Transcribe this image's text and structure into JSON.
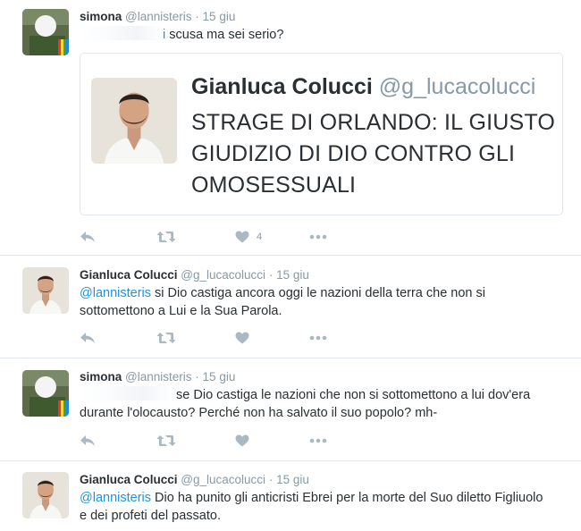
{
  "tweets": [
    {
      "name": "simona",
      "handle": "@lannisteris",
      "date": "15 giu",
      "redacted": "@g_lucacolucci",
      "redacted_tail": "i",
      "text": " scusa ma sei serio?",
      "likes": "4",
      "quote": {
        "name": "Gianluca Colucci",
        "handle": "@g_lucacolucci",
        "text": "STRAGE DI ORLANDO: IL GIUSTO GIUDIZIO DI DIO CONTRO GLI OMOSESSUALI"
      }
    },
    {
      "name": "Gianluca Colucci",
      "handle": "@g_lucacolucci",
      "date": "15 giu",
      "mention": "@lannisteris",
      "text_line1": " si Dio castiga ancora oggi le nazioni della terra che non si",
      "text_line2": "sottomettono a Lui e la Sua Parola."
    },
    {
      "name": "simona",
      "handle": "@lannisteris",
      "date": "15 giu",
      "redacted": "@g_lucacolucci",
      "text_line1": " se Dio castiga le nazioni che non si sottomettono a lui dov'era",
      "text_line2": "durante l'olocausto? Perché non ha salvato il suo popolo? mh-"
    },
    {
      "name": "Gianluca Colucci",
      "handle": "@g_lucacolucci",
      "date": "15 giu",
      "mention": "@lannisteris",
      "text_line1": " Dio ha punito gli anticristi Ebrei per la morte del Suo diletto Figliuolo",
      "text_line2": "e dei profeti del passato."
    }
  ],
  "separator": "·",
  "icons": [
    "reply-icon",
    "retweet-icon",
    "like-icon",
    "more-icon"
  ],
  "colors": {
    "link": "#1b95e0",
    "muted": "#8899a6",
    "icon": "#aab8c2",
    "border": "#e1e8ed"
  }
}
